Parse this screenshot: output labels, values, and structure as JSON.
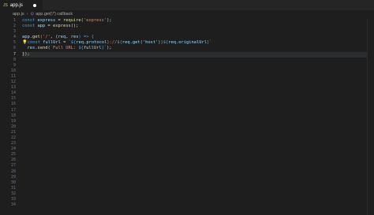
{
  "tab": {
    "filename": "app.js",
    "icon": "JS",
    "modified": true
  },
  "breadcrumb": {
    "file": "app.js",
    "symbol": "app.get('/') callback"
  },
  "line_numbers": [
    "1",
    "2",
    "3",
    "4",
    "5",
    "6",
    "7",
    "8",
    "9",
    "10",
    "11",
    "12",
    "13",
    "14",
    "15",
    "16",
    "17",
    "18",
    "19",
    "20",
    "21",
    "22",
    "23",
    "24",
    "25",
    "26",
    "27",
    "28",
    "29",
    "30",
    "31",
    "32",
    "33",
    "34"
  ],
  "code": {
    "l1": [
      "const",
      " express ",
      "=",
      " require",
      "(",
      "'express'",
      ");"
    ],
    "l2": [
      "const",
      " app ",
      "=",
      " express",
      "();"
    ],
    "l4": [
      "app",
      ".get",
      "('/'",
      ", (",
      "req",
      ", ",
      "res",
      ") => {"
    ],
    "l5": [
      "const",
      " fullUrl ",
      "= ",
      "`",
      "${",
      "req.protocol",
      "}",
      "://",
      "${",
      "req.get('host')",
      "}",
      "${",
      "req.originalUrl",
      "}",
      "`"
    ],
    "l6": [
      "res",
      ".send",
      "(",
      "`Full URL: ",
      "${",
      "fullUrl",
      "}",
      "`",
      ");"
    ],
    "l7": [
      "});"
    ]
  },
  "colors": {
    "background": "#1e1e1e",
    "keyword": "#569cd6",
    "string": "#ce9178",
    "function": "#dcdcaa",
    "variable": "#9cdcfe"
  }
}
